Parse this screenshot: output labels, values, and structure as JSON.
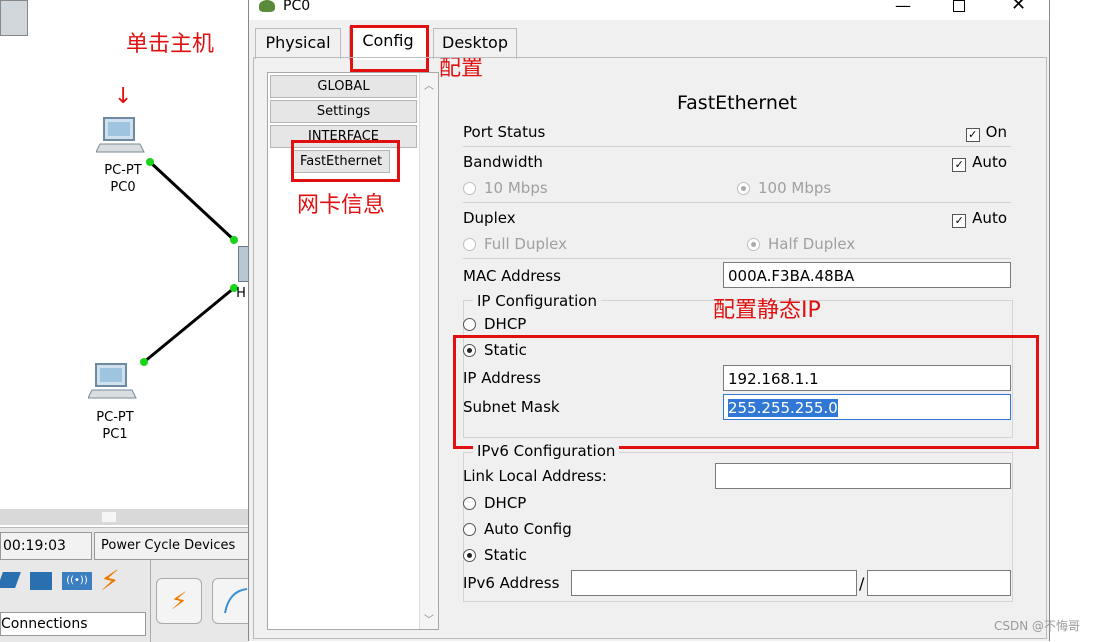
{
  "workspace": {
    "annotation_click": "单击主机",
    "pc0": {
      "type_label": "PC-PT",
      "name_label": "PC0"
    },
    "pc1": {
      "type_label": "PC-PT",
      "name_label": "PC1"
    },
    "hub_partial": "H",
    "time": "00:19:03",
    "power_cycle_label": "Power Cycle Devices",
    "connections_label": "Connections"
  },
  "window": {
    "title": "PC0",
    "tabs": [
      "Physical",
      "Config",
      "Desktop"
    ],
    "active_tab": "Config",
    "annotation_config": "配置",
    "annotation_nic": "网卡信息",
    "annotation_static_ip": "配置静态IP"
  },
  "nav": {
    "items": [
      "GLOBAL",
      "Settings",
      "INTERFACE",
      "FastEthernet"
    ]
  },
  "panel": {
    "title": "FastEthernet",
    "port_status": {
      "label": "Port Status",
      "checkbox_label": "On",
      "checked": true
    },
    "bandwidth": {
      "label": "Bandwidth",
      "checkbox_label": "Auto",
      "options": [
        "10 Mbps",
        "100 Mbps"
      ],
      "selected": "100 Mbps"
    },
    "duplex": {
      "label": "Duplex",
      "checkbox_label": "Auto",
      "options": [
        "Full Duplex",
        "Half Duplex"
      ],
      "selected": "Half Duplex"
    },
    "mac": {
      "label": "MAC Address",
      "value": "000A.F3BA.48BA"
    },
    "ip_config": {
      "legend": "IP Configuration",
      "dhcp_label": "DHCP",
      "static_label": "Static",
      "mode": "Static",
      "ip_label": "IP Address",
      "ip_value": "192.168.1.1",
      "mask_label": "Subnet Mask",
      "mask_value": "255.255.255.0"
    },
    "ipv6_config": {
      "legend": "IPv6 Configuration",
      "link_local_label": "Link Local Address:",
      "link_local_value": "",
      "dhcp_label": "DHCP",
      "auto_label": "Auto Config",
      "static_label": "Static",
      "mode": "Static",
      "addr_label": "IPv6 Address",
      "addr_value": "",
      "prefix_value": "",
      "separator": "/"
    }
  },
  "watermark": "CSDN @不悔哥",
  "colors": {
    "annotation_red": "#e01010",
    "selection_blue": "#3178d6",
    "link_green": "#19d419"
  }
}
